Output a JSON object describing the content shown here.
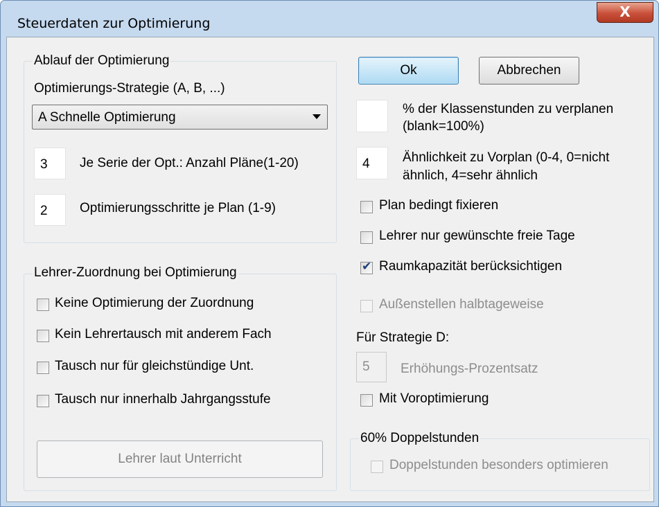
{
  "window": {
    "title": "Steuerdaten zur Optimierung",
    "close_glyph": "X"
  },
  "ablauf": {
    "legend": "Ablauf der Optimierung",
    "strategie_label": "Optimierungs-Strategie (A, B, ...)",
    "strategie_selected": "A Schnelle Optimierung",
    "anzahl_value": "3",
    "anzahl_label": "Je Serie der Opt.: Anzahl Pläne(1-20)",
    "schritte_value": "2",
    "schritte_label": "Optimierungsschritte je Plan (1-9)"
  },
  "lehrer": {
    "legend": "Lehrer-Zuordnung bei Optimierung",
    "options": [
      {
        "label": "Keine Optimierung der Zuordnung",
        "checked": false
      },
      {
        "label": "Kein Lehrertausch mit anderem Fach",
        "checked": false
      },
      {
        "label": "Tausch nur für gleichstündige Unt.",
        "checked": false
      },
      {
        "label": "Tausch nur innerhalb Jahrgangsstufe",
        "checked": false
      }
    ],
    "button_label": "Lehrer laut Unterricht"
  },
  "buttons": {
    "ok": "Ok",
    "cancel": "Abbrechen"
  },
  "right": {
    "klassenstunden_value": "",
    "klassenstunden_label_1": "% der Klassenstunden zu verplanen",
    "klassenstunden_label_2": "(blank=100%)",
    "aehnlichkeit_value": "4",
    "aehnlichkeit_label_1": "Ähnlichkeit zu Vorplan (0-4, 0=nicht",
    "aehnlichkeit_label_2": "ähnlich, 4=sehr ähnlich",
    "options": [
      {
        "label": "Plan bedingt fixieren",
        "checked": false
      },
      {
        "label": "Lehrer nur gewünschte freie Tage",
        "checked": false
      },
      {
        "label": "Raumkapazität berücksichtigen",
        "checked": true
      },
      {
        "label": "Außenstellen halbtageweise",
        "checked": false,
        "disabled": true
      }
    ],
    "strategie_d_label": "Für Strategie D:",
    "erhoehung_value": "5",
    "erhoehung_label": "Erhöhungs-Prozentsatz",
    "vor_opt_label": "Mit Voroptimierung",
    "doppel_legend": "60% Doppelstunden",
    "doppel_label": "Doppelstunden besonders optimieren"
  }
}
